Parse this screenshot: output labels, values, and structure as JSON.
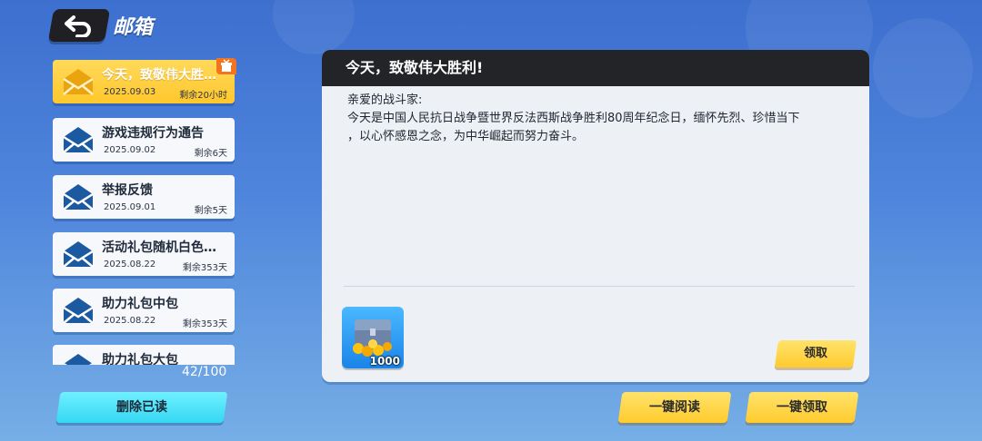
{
  "header": {
    "title": "邮箱"
  },
  "mails": [
    {
      "subject": "今天，致敬伟大胜利！",
      "date": "2025.09.03",
      "remain": "剩余20小时",
      "active": true
    },
    {
      "subject": "游戏违规行为通告",
      "date": "2025.09.02",
      "remain": "剩余6天",
      "active": false
    },
    {
      "subject": "举报反馈",
      "date": "2025.09.01",
      "remain": "剩余5天",
      "active": false
    },
    {
      "subject": "活动礼包随机白色品质",
      "date": "2025.08.22",
      "remain": "剩余353天",
      "active": false
    },
    {
      "subject": "助力礼包中包",
      "date": "2025.08.22",
      "remain": "剩余353天",
      "active": false
    },
    {
      "subject": "助力礼包大包",
      "date": "",
      "remain": "",
      "active": false
    }
  ],
  "mail_count": "42/100",
  "buttons": {
    "delete_read": "删除已读",
    "read_all": "一键阅读",
    "claim_all": "一键领取",
    "claim": "领取"
  },
  "detail": {
    "title": "今天，致敬伟大胜利!",
    "greeting": "亲爱的战斗家:",
    "body_line1": "今天是中国人民抗日战争暨世界反法西斯战争胜利80周年纪念日，缅怀先烈、珍惜当下",
    "body_line2": "，以心怀感恩之念，为中华崛起而努力奋斗。",
    "attachment": {
      "icon": "treasure-chest-gold-icon",
      "quantity": "1000"
    }
  },
  "colors": {
    "active_item": "#ffc72c",
    "envelope": "#1b5aa0",
    "panel_header": "#232428"
  }
}
